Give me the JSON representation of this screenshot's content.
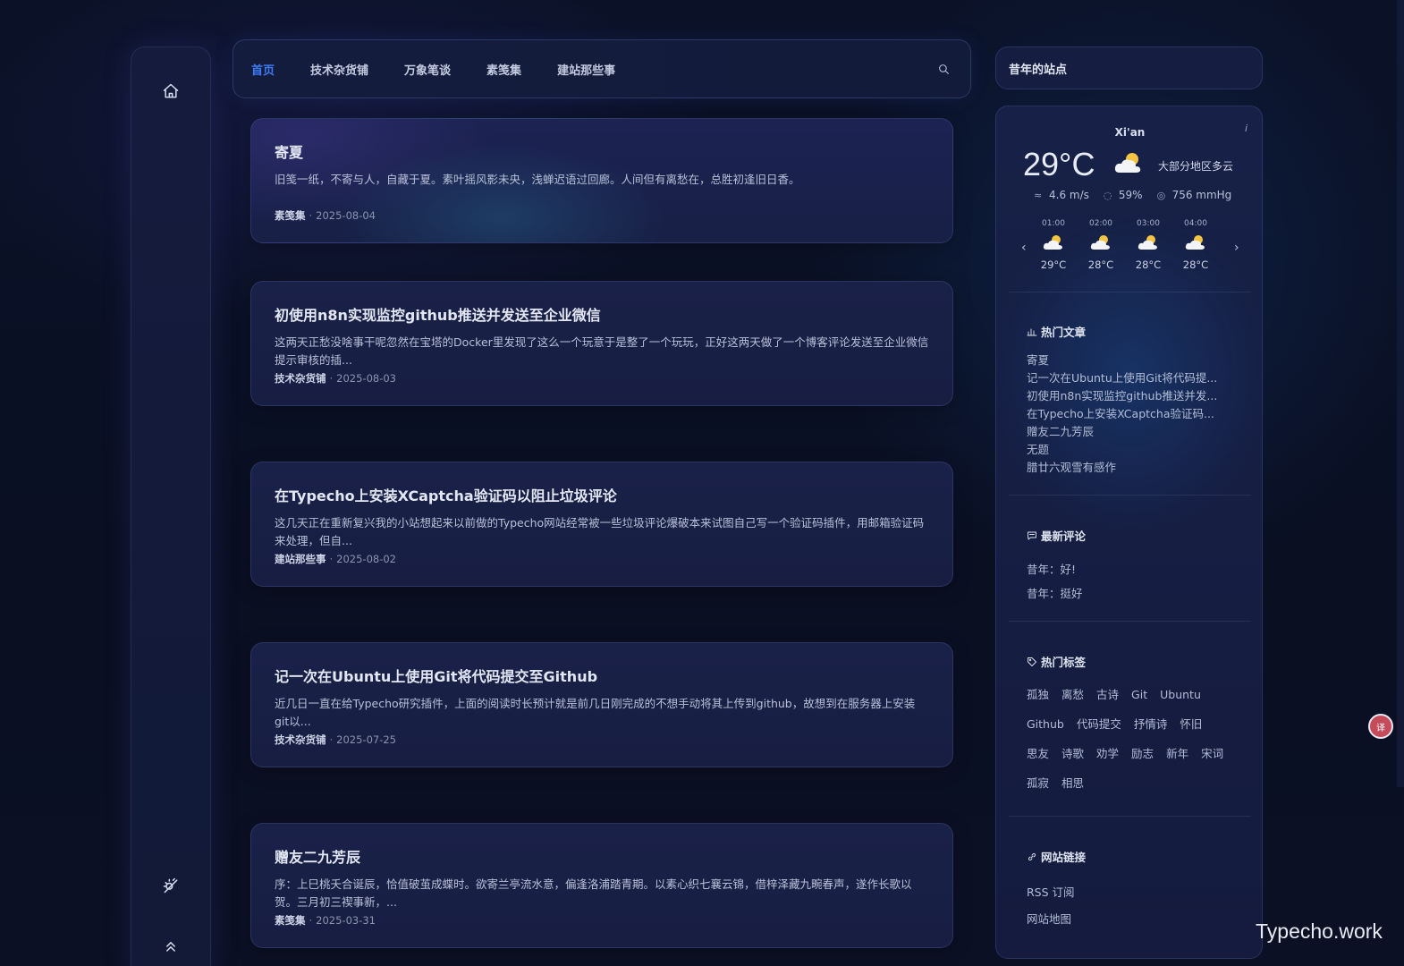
{
  "nav": {
    "items": [
      {
        "label": "首页",
        "active": true
      },
      {
        "label": "技术杂货铺",
        "active": false
      },
      {
        "label": "万象笔谈",
        "active": false
      },
      {
        "label": "素笺集",
        "active": false
      },
      {
        "label": "建站那些事",
        "active": false
      }
    ]
  },
  "posts": [
    {
      "title": "寄夏",
      "excerpt": "旧笺一纸，不寄与人，自藏于夏。素叶摇风影未央，浅蝉迟语过回廊。人间但有离愁在，总胜初逢旧日香。",
      "category": "素笺集",
      "separator": "·",
      "date": "2025-08-04"
    },
    {
      "title": "初使用n8n实现监控github推送并发送至企业微信",
      "excerpt": "这两天正愁没啥事干呢忽然在宝塔的Docker里发现了这么一个玩意于是整了一个玩玩，正好这两天做了一个博客评论发送至企业微信提示审核的插...",
      "category": "技术杂货铺",
      "separator": "·",
      "date": "2025-08-03"
    },
    {
      "title": "在Typecho上安装XCaptcha验证码以阻止垃圾评论",
      "excerpt": "这几天正在重新复兴我的小站想起来以前做的Typecho网站经常被一些垃圾评论爆破本来试图自己写一个验证码插件，用邮箱验证码来处理，但自...",
      "category": "建站那些事",
      "separator": "·",
      "date": "2025-08-02"
    },
    {
      "title": "记一次在Ubuntu上使用Git将代码提交至Github",
      "excerpt": "近几日一直在给Typecho研究插件，上面的阅读时长预计就是前几日刚完成的不想手动将其上传到github，故想到在服务器上安装git以...",
      "category": "技术杂货铺",
      "separator": "·",
      "date": "2025-07-25"
    },
    {
      "title": "赠友二九芳辰",
      "excerpt": "序：上巳桃夭合诞辰，恰值破茧成蝶时。欲寄兰亭流水意，偏逢洛浦踏青期。以素心织七襄云锦，借梓泽藏九畹春声，遂作长歌以贺。三月初三禊事新，...",
      "category": "素笺集",
      "separator": "·",
      "date": "2025-03-31"
    }
  ],
  "sidebar": {
    "site_title": "昔年的站点",
    "weather": {
      "city": "Xi'an",
      "info_icon": "i",
      "temp": "29°C",
      "desc": "大部分地区多云",
      "wind": "4.6 m/s",
      "humidity": "59%",
      "pressure": "756 mmHg",
      "prev_arrow": "‹",
      "next_arrow": "›",
      "hours": [
        {
          "time": "01:00",
          "temp": "29°C"
        },
        {
          "time": "02:00",
          "temp": "28°C"
        },
        {
          "time": "03:00",
          "temp": "28°C"
        },
        {
          "time": "04:00",
          "temp": "28°C"
        }
      ]
    },
    "hot_posts": {
      "title": "热门文章",
      "items": [
        "寄夏",
        "记一次在Ubuntu上使用Git将代码提...",
        "初使用n8n实现监控github推送并发...",
        "在Typecho上安装XCaptcha验证码...",
        "赠友二九芳辰",
        "无题",
        "腊廿六观雪有感作"
      ]
    },
    "comments": {
      "title": "最新评论",
      "items": [
        "昔年：好!",
        "昔年：挺好"
      ]
    },
    "tags": {
      "title": "热门标签",
      "items": [
        "孤独",
        "离愁",
        "古诗",
        "Git",
        "Ubuntu",
        "Github",
        "代码提交",
        "抒情诗",
        "怀旧",
        "思友",
        "诗歌",
        "劝学",
        "励志",
        "新年",
        "宋词",
        "孤寂",
        "相思"
      ]
    },
    "links": {
      "title": "网站链接",
      "items": [
        "RSS 订阅",
        "网站地图"
      ]
    }
  },
  "float_badge": "译",
  "watermark": "Typecho.work"
}
